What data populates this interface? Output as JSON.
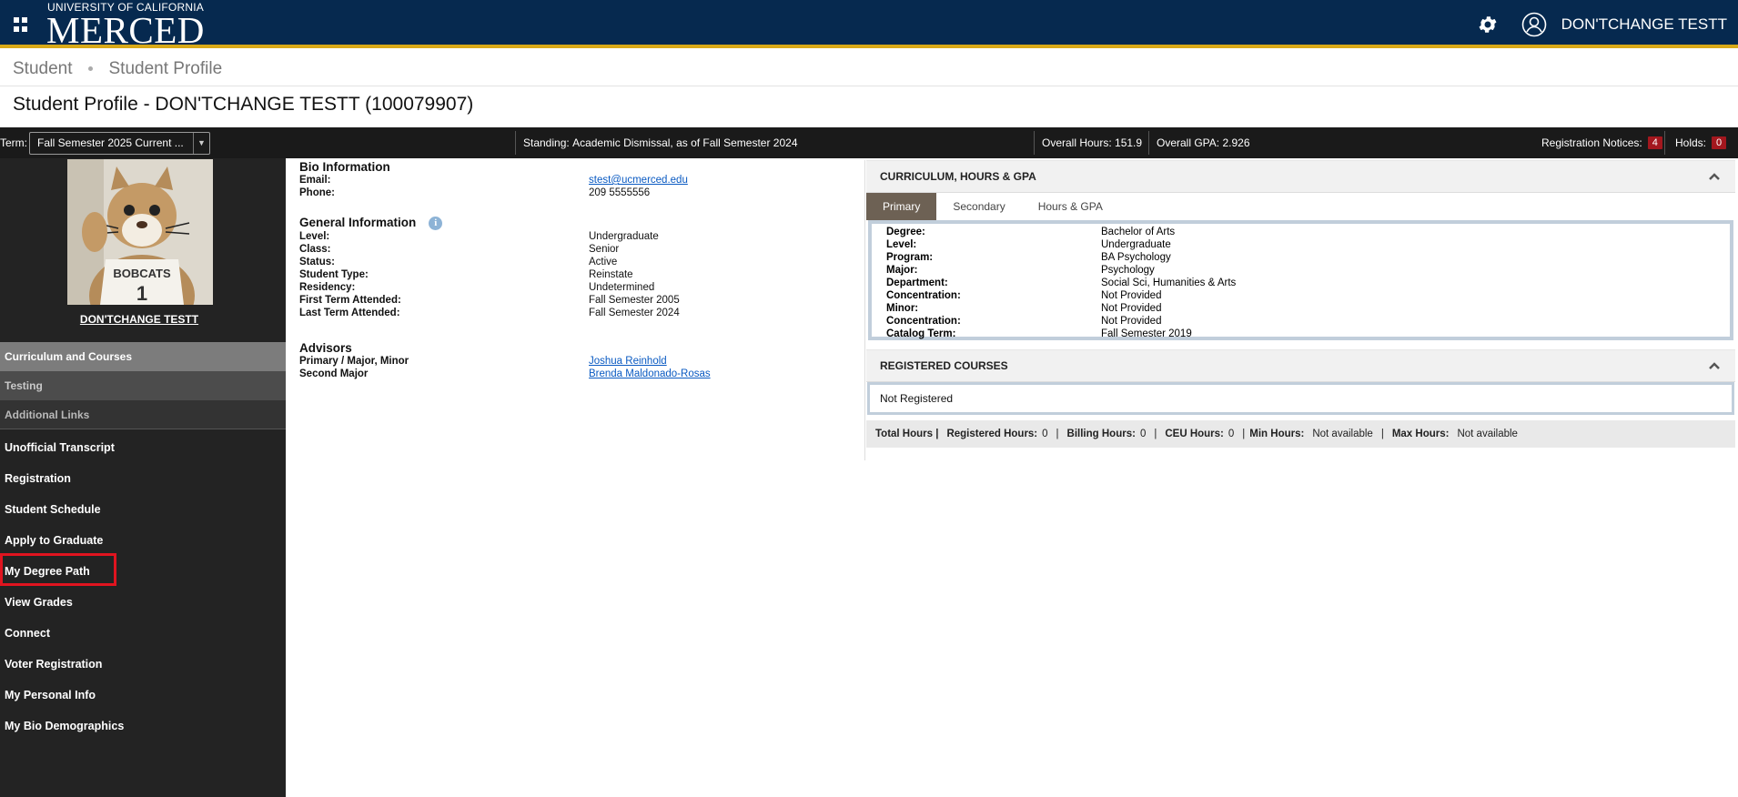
{
  "header": {
    "logo_small": "UNIVERSITY OF CALIFORNIA",
    "logo_big": "MERCED",
    "user_name": "DON'TCHANGE TESTT",
    "icons": [
      "apps-grid-icon",
      "gear-icon",
      "user-icon"
    ]
  },
  "breadcrumb": {
    "items": [
      "Student",
      "Student Profile"
    ]
  },
  "page_title": "Student Profile - DON'TCHANGE TESTT (100079907)",
  "infobar": {
    "term_label": "Term:",
    "term_value": "Fall Semester 2025 Current ...",
    "standing_label": "Standing:",
    "standing_value": "Academic Dismissal, as of Fall Semester 2024",
    "overall_hours_label": "Overall Hours:",
    "overall_hours_value": "151.9",
    "overall_gpa_label": "Overall GPA:",
    "overall_gpa_value": "2.926",
    "reg_notices_label": "Registration Notices:",
    "reg_notices_count": "4",
    "holds_label": "Holds:",
    "holds_count": "0"
  },
  "sidebar": {
    "student_name": "DON'TCHANGE TESTT",
    "photo_text": "BOBCATS 1",
    "sections": [
      "Curriculum and Courses",
      "Testing",
      "Additional Links"
    ],
    "links": [
      "Unofficial Transcript",
      "Registration",
      "Student Schedule",
      "Apply to Graduate",
      "My Degree Path",
      "View Grades",
      "Connect",
      "Voter Registration",
      "My Personal Info",
      "My Bio Demographics"
    ]
  },
  "bio": {
    "title": "Bio Information",
    "email_label": "Email:",
    "email_value": "stest@ucmerced.edu",
    "phone_label": "Phone:",
    "phone_value": "209 5555556"
  },
  "general": {
    "title": "General Information",
    "rows": [
      {
        "label": "Level:",
        "value": "Undergraduate"
      },
      {
        "label": "Class:",
        "value": "Senior"
      },
      {
        "label": "Status:",
        "value": "Active"
      },
      {
        "label": "Student Type:",
        "value": "Reinstate"
      },
      {
        "label": "Residency:",
        "value": "Undetermined"
      },
      {
        "label": "First Term Attended:",
        "value": "Fall Semester 2005"
      },
      {
        "label": "Last Term Attended:",
        "value": "Fall Semester 2024"
      }
    ]
  },
  "advisors": {
    "title": "Advisors",
    "rows": [
      {
        "label": "Primary / Major, Minor",
        "value": "Joshua Reinhold"
      },
      {
        "label": "Second Major",
        "value": "Brenda Maldonado-Rosas"
      }
    ]
  },
  "curriculum": {
    "title": "CURRICULUM, HOURS & GPA",
    "tabs": [
      "Primary",
      "Secondary",
      "Hours & GPA"
    ],
    "rows": [
      {
        "label": "Degree:",
        "value": "Bachelor of Arts"
      },
      {
        "label": "Level:",
        "value": "Undergraduate"
      },
      {
        "label": "Program:",
        "value": "BA Psychology"
      },
      {
        "label": "Major:",
        "value": "Psychology"
      },
      {
        "label": "Department:",
        "value": "Social Sci, Humanities & Arts"
      },
      {
        "label": "Concentration:",
        "value": "Not Provided"
      },
      {
        "label": "Minor:",
        "value": "Not Provided"
      },
      {
        "label": "Concentration:",
        "value": "Not Provided"
      },
      {
        "label": "Catalog Term:",
        "value": "Fall Semester 2019"
      }
    ]
  },
  "registered": {
    "title": "REGISTERED COURSES",
    "status": "Not Registered",
    "total_hours_label": "Total Hours |",
    "registered_hours_label": "Registered Hours:",
    "registered_hours_value": "0",
    "billing_hours_label": "Billing Hours:",
    "billing_hours_value": "0",
    "ceu_hours_label": "CEU Hours:",
    "ceu_hours_value": "0",
    "min_hours_label": "Min Hours:",
    "min_hours_value": "Not available",
    "max_hours_label": "Max Hours:",
    "max_hours_value": "Not available"
  },
  "colors": {
    "header_bg": "#06294f",
    "header_accent": "#d9a918",
    "badge": "#a3171e",
    "active_tab": "#6d6154",
    "highlight_box": "#e0141f"
  }
}
